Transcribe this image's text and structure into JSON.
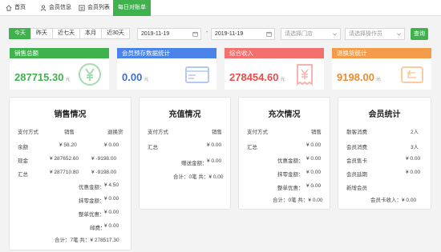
{
  "tabs": [
    {
      "label": "首页",
      "icon": "home-icon"
    },
    {
      "label": "会员信息",
      "icon": "user-icon"
    },
    {
      "label": "会员列表",
      "icon": "list-icon"
    },
    {
      "label": "每日对账单",
      "active": true
    }
  ],
  "filter": {
    "quick": [
      "今天",
      "昨天",
      "近七天",
      "本月",
      "近30天"
    ],
    "start_date": "2019-11-19",
    "end_date": "2019-11-19",
    "separator": "-",
    "store_placeholder": "请选择门店",
    "operator_placeholder": "请选择操作员",
    "query_label": "查询"
  },
  "summary": [
    {
      "title": "销售总额",
      "value": "287715.30",
      "unit": "元",
      "color": "#3fb24e",
      "value_color": "#3fb24e",
      "icon": "yuan-circle-icon"
    },
    {
      "title": "会员预存数据统计",
      "value": "0.00",
      "unit": "元",
      "color": "#4a84e8",
      "value_color": "#3a6fd8",
      "icon": "vip-card-icon"
    },
    {
      "title": "综合收入",
      "value": "278454.60",
      "unit": "元",
      "color": "#f2706d",
      "value_color": "#ea4c4a",
      "icon": "receipt-icon"
    },
    {
      "title": "退换货统计",
      "value": "9198.00",
      "unit": "元",
      "color": "#f49c4a",
      "value_color": "#ef8a2e",
      "icon": "wallet-return-icon"
    }
  ],
  "sales": {
    "title": "销售情况",
    "headers": [
      "支付方式",
      "销售",
      "退换货"
    ],
    "rows": [
      [
        "余额",
        "¥ 58.20",
        "¥ 0.00"
      ],
      [
        "现金",
        "¥ 287652.60",
        "¥ -9198.00"
      ],
      [
        "汇总",
        "¥ 287710.80",
        "¥ -9198.00"
      ]
    ],
    "extras": [
      [
        "优惠金额：",
        "¥ 4.50"
      ],
      [
        "抹零金额：",
        "¥ 0.00"
      ],
      [
        "整单优惠：",
        "¥ 0.00"
      ],
      [
        "邮费：",
        "¥ 0.00"
      ]
    ],
    "total": "合计：7笔 共：¥ 278517.30"
  },
  "recharge": {
    "title": "充值情况",
    "headers": [
      "支付方式",
      "销售"
    ],
    "rows": [
      [
        "汇总",
        "¥ 0.00"
      ]
    ],
    "gift": [
      "赠送金额：",
      "¥ 0.00"
    ],
    "total": "合计：0笔 共：¥ 0.00"
  },
  "count": {
    "title": "充次情况",
    "headers": [
      "支付方式",
      "销售"
    ],
    "rows": [
      [
        "汇总",
        "¥ 0.00"
      ]
    ],
    "extras": [
      [
        "优惠金额：",
        "¥ 0.00"
      ],
      [
        "抹零金额：",
        "¥ 0.00"
      ],
      [
        "整单优惠：",
        "¥ 0.00"
      ]
    ],
    "total": "合计：0笔 共：¥ 0.00"
  },
  "members": {
    "title": "会员统计",
    "rows": [
      [
        "散客消费",
        "2人"
      ],
      [
        "会员消费",
        "3人"
      ],
      [
        "会员售卡",
        "¥ 0.00"
      ],
      [
        "会员延期",
        "¥ 0.00"
      ],
      [
        "新增会员",
        ""
      ]
    ],
    "card_income": "会员卡收入：¥ 0.00"
  }
}
